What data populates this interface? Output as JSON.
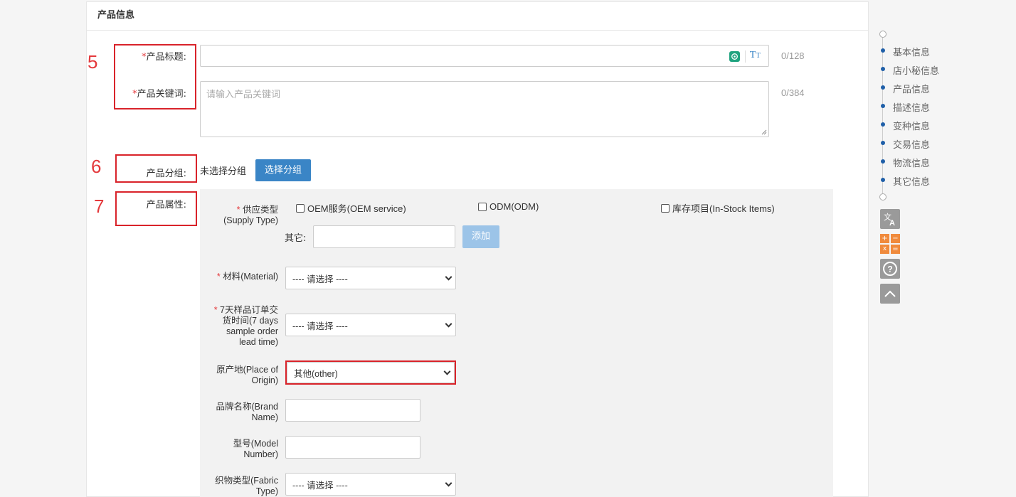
{
  "section_title": "产品信息",
  "annotations": {
    "n5": "5",
    "n6": "6",
    "n7": "7"
  },
  "title_field": {
    "required_mark": "*",
    "label": "产品标题:",
    "value": "",
    "counter": "0/128"
  },
  "keywords_field": {
    "required_mark": "*",
    "label": "产品关键词:",
    "placeholder": "请输入产品关键词",
    "counter": "0/384"
  },
  "group_field": {
    "label": "产品分组:",
    "value": "未选择分组",
    "button": "选择分组"
  },
  "attributes": {
    "label": "产品属性:",
    "supply_type": {
      "required_mark": "*",
      "label_line1": "供应类型",
      "label_line2": "(Supply Type)",
      "options": [
        "OEM服务(OEM service)",
        "ODM(ODM)",
        "库存项目(In-Stock Items)"
      ],
      "other_label": "其它:",
      "other_value": "",
      "add_button": "添加"
    },
    "material": {
      "required_mark": "*",
      "label": "材料(Material)",
      "selected": "---- 请选择 ----"
    },
    "lead_time": {
      "required_mark": "*",
      "label_lines": [
        "7天样品订单交",
        "货时间(7 days",
        "sample order",
        "lead time)"
      ],
      "selected": "---- 请选择 ----"
    },
    "origin": {
      "label_lines": [
        "原产地(Place of",
        "Origin)"
      ],
      "selected": "其他(other)"
    },
    "brand": {
      "label_lines": [
        "品牌名称(Brand",
        "Name)"
      ],
      "value": ""
    },
    "model": {
      "label_lines": [
        "型号(Model",
        "Number)"
      ],
      "value": ""
    },
    "fabric": {
      "label_lines": [
        "织物类型(Fabric",
        "Type)"
      ],
      "selected": "---- 请选择 ----"
    }
  },
  "side_nav": {
    "items": [
      "基本信息",
      "店小秘信息",
      "产品信息",
      "描述信息",
      "变种信息",
      "交易信息",
      "物流信息",
      "其它信息"
    ]
  },
  "tools": [
    "translate-icon",
    "calculator-icon",
    "help-icon",
    "back-to-top-icon"
  ],
  "colors": {
    "annotation_red": "#d9232a",
    "primary_blue": "#3a85c6",
    "nav_dot": "#1f5fa8"
  }
}
